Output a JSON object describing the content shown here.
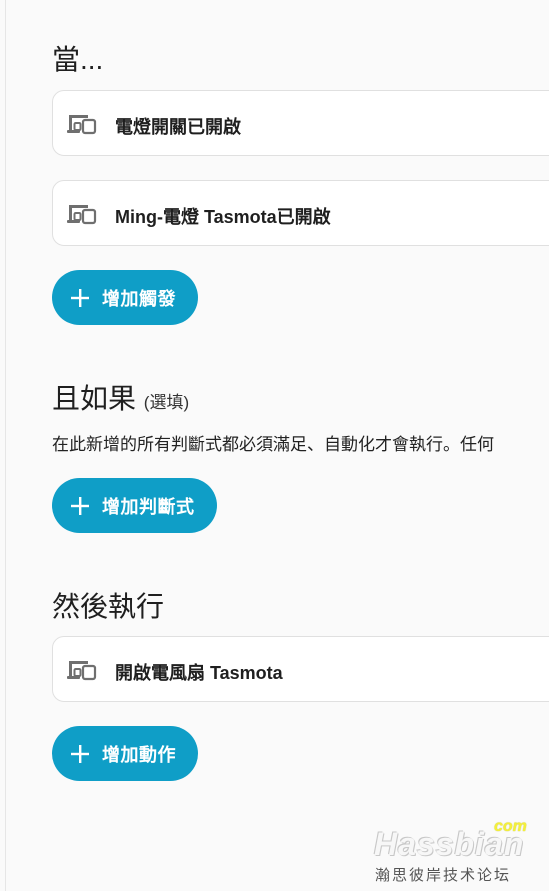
{
  "triggers": {
    "title": "當...",
    "items": [
      {
        "icon": "device-icon",
        "label": "電燈開關已開啟"
      },
      {
        "icon": "device-icon",
        "label": "Ming-電燈 Tasmota已開啟"
      }
    ],
    "add_button": "增加觸發"
  },
  "conditions": {
    "title": "且如果",
    "optional_label": "(選填)",
    "description": "在此新增的所有判斷式都必須滿足、自動化才會執行。任何",
    "add_button": "增加判斷式"
  },
  "actions": {
    "title": "然後執行",
    "items": [
      {
        "icon": "device-icon",
        "label": "開啟電風扇 Tasmota"
      }
    ],
    "add_button": "增加動作"
  },
  "watermark": {
    "brand": "Hassbian",
    "suffix": "com",
    "subtitle": "瀚思彼岸技术论坛"
  },
  "colors": {
    "accent": "#0f9ec7",
    "card_border": "#e0e0e0",
    "background": "#fafafa"
  }
}
